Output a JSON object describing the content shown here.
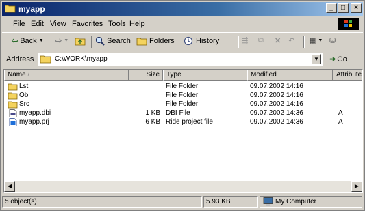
{
  "window": {
    "title": "myapp"
  },
  "menu": {
    "items": [
      {
        "label": "File",
        "key": "F"
      },
      {
        "label": "Edit",
        "key": "E"
      },
      {
        "label": "View",
        "key": "V"
      },
      {
        "label": "Favorites",
        "key": "a"
      },
      {
        "label": "Tools",
        "key": "T"
      },
      {
        "label": "Help",
        "key": "H"
      }
    ]
  },
  "toolbar": {
    "back_label": "Back",
    "search_label": "Search",
    "folders_label": "Folders",
    "history_label": "History"
  },
  "address": {
    "label": "Address",
    "value": "C:\\WORK\\myapp",
    "go_label": "Go"
  },
  "columns": [
    {
      "label": "Name"
    },
    {
      "label": "Size"
    },
    {
      "label": "Type"
    },
    {
      "label": "Modified"
    },
    {
      "label": "Attributes"
    }
  ],
  "files": [
    {
      "name": "Lst",
      "size": "",
      "type": "File Folder",
      "modified": "09.07.2002 14:16",
      "attributes": "",
      "icon": "folder-icon"
    },
    {
      "name": "Obj",
      "size": "",
      "type": "File Folder",
      "modified": "09.07.2002 14:16",
      "attributes": "",
      "icon": "folder-icon"
    },
    {
      "name": "Src",
      "size": "",
      "type": "File Folder",
      "modified": "09.07.2002 14:16",
      "attributes": "",
      "icon": "folder-icon"
    },
    {
      "name": "myapp.dbi",
      "size": "1 KB",
      "type": "DBI File",
      "modified": "09.07.2002 14:36",
      "attributes": "A",
      "icon": "file-icon"
    },
    {
      "name": "myapp.prj",
      "size": "6 KB",
      "type": "Ride project file",
      "modified": "09.07.2002 14:36",
      "attributes": "A",
      "icon": "project-file-icon"
    }
  ],
  "status": {
    "objects": "5 object(s)",
    "size": "5.93 KB",
    "zone": "My Computer"
  },
  "colors": {
    "title_active": "#0a246a",
    "folder": "#f4d35e",
    "chrome": "#d4d0c8"
  }
}
